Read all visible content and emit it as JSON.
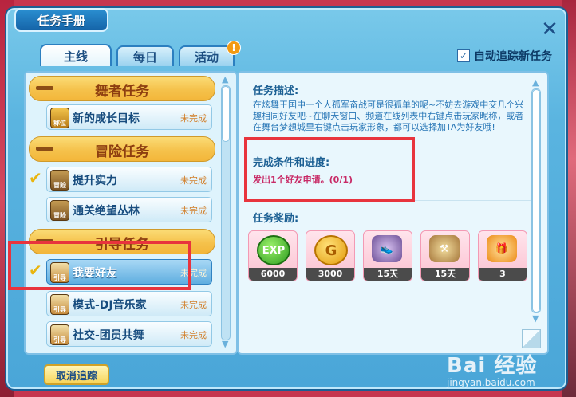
{
  "window": {
    "title": "任务手册",
    "close_glyph": "✕"
  },
  "tabs": [
    {
      "label": "主线",
      "active": true
    },
    {
      "label": "每日",
      "active": false
    },
    {
      "label": "活动",
      "active": false,
      "badge": "!"
    }
  ],
  "auto_track": {
    "label": "自动追踪新任务",
    "checked": true,
    "check_glyph": "✓"
  },
  "categories": [
    {
      "title": "舞者任务",
      "quests": [
        {
          "name": "新的成长目标",
          "status": "未完成",
          "icon_text": "称位",
          "tracked": false
        }
      ]
    },
    {
      "title": "冒险任务",
      "quests": [
        {
          "name": "提升实力",
          "status": "未完成",
          "icon_text": "冒险",
          "tracked": true
        },
        {
          "name": "通关绝望丛林",
          "status": "未完成",
          "icon_text": "冒险",
          "tracked": false
        }
      ]
    },
    {
      "title": "引导任务",
      "quests": [
        {
          "name": "我要好友",
          "status": "未完成",
          "icon_text": "引导",
          "tracked": true,
          "selected": true
        },
        {
          "name": "模式-DJ音乐家",
          "status": "未完成",
          "icon_text": "引导",
          "tracked": false
        },
        {
          "name": "社交-团员共舞",
          "status": "未完成",
          "icon_text": "引导",
          "tracked": false
        }
      ]
    }
  ],
  "detail": {
    "desc_title": "任务描述:",
    "description": "在炫舞王国中一个人孤军奋战可是很孤单的呢~不妨去游戏中交几个兴趣相同好友吧~在聊天窗口、频道在线列表中右键点击玩家昵称，或者在舞台梦想城里右键点击玩家形象，都可以选择加TA为好友哦!",
    "progress_title": "完成条件和进度:",
    "progress": "发出1个好友申请。(0/1)",
    "reward_title": "任务奖励:",
    "rewards": [
      {
        "icon": "exp-icon",
        "icon_text": "EXP",
        "amount": "6000"
      },
      {
        "icon": "gold-coin-icon",
        "icon_text": "G",
        "amount": "3000"
      },
      {
        "icon": "sneaker-icon",
        "icon_text": "👟",
        "amount": "15天"
      },
      {
        "icon": "hoe-item-icon",
        "icon_text": "⚒",
        "amount": "15天"
      },
      {
        "icon": "gift-bag-icon",
        "icon_text": "🎁",
        "amount": "3"
      }
    ]
  },
  "cancel_button": "取消追踪",
  "watermark": {
    "main": "Bai 经验",
    "sub": "jingyan.baidu.com"
  },
  "colors": {
    "highlight_box": "#e8343d",
    "panel_bg": "#4aa6d8"
  }
}
